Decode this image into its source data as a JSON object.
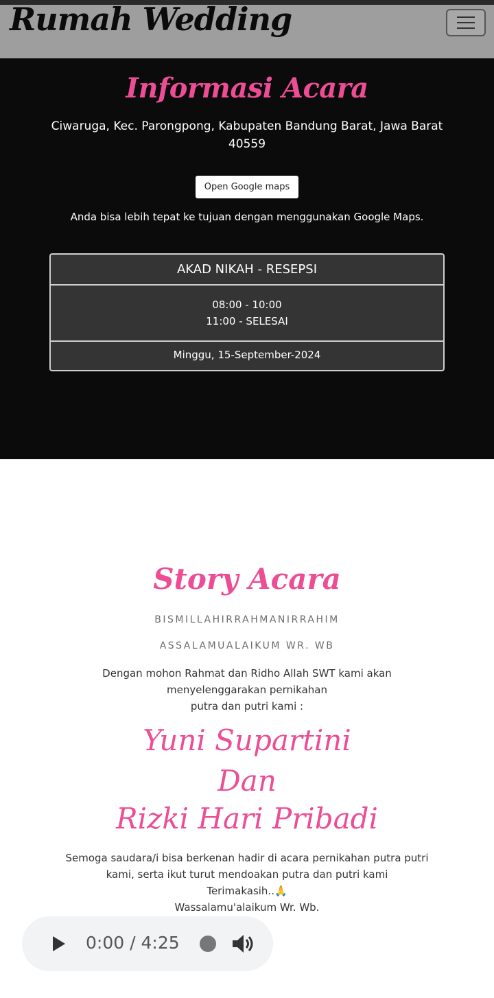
{
  "navbar": {
    "brand": "Rumah Wedding",
    "menu_icon": "hamburger-menu-icon"
  },
  "event_info": {
    "title": "Informasi Acara",
    "address": "Ciwaruga, Kec. Parongpong, Kabupaten Bandung Barat, Jawa Barat 40559",
    "maps_button": "Open Google maps",
    "maps_note": "Anda bisa lebih tepat ke tujuan dengan menggunakan Google Maps.",
    "card": {
      "header": "AKAD NIKAH - RESEPSI",
      "times": [
        "08:00 - 10:00",
        "11:00 - SELESAI"
      ],
      "date": "Minggu, 15-September-2024"
    }
  },
  "story": {
    "title": "Story Acara",
    "line1": "BISMILLAHIRRAHMANIRRAHIM",
    "line2": "ASSALAMUALAIKUM WR. WB",
    "intro": [
      "Dengan mohon Rahmat dan Ridho Allah SWT kami akan",
      "menyelenggarakan pernikahan",
      "putra dan putri kami :"
    ],
    "bride": "Yuni Supartini",
    "conjunction": "Dan",
    "groom": "Rizki Hari Pribadi",
    "closing": [
      "Semoga saudara/i bisa berkenan hadir di acara pernikahan putra putri",
      "kami, serta ikut turut mendoakan putra dan putri kami",
      "Terimakasih..🙏",
      "Wassalamu'alaikum Wr. Wb."
    ]
  },
  "audio_player": {
    "current_time": "0:00",
    "separator": "/",
    "duration": "4:25",
    "progress": 0
  },
  "colors": {
    "accent_pink": "#ec4d95",
    "dark_section": "#0b0b0b",
    "navbar": "#9e9e9e",
    "card": "#343434"
  }
}
